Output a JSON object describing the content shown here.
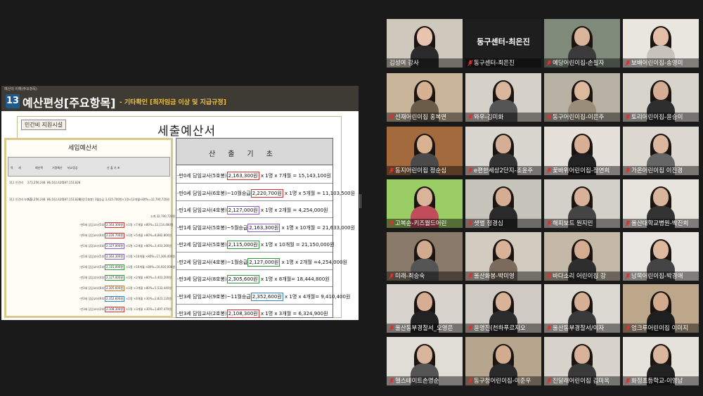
{
  "slide": {
    "header_small": "예산의 이해(주요항목)",
    "number": "13",
    "title": "예산편성[주요항목]",
    "subtitle": "- 기타확인 [최저임금 이상 및 지급규정]",
    "tag": "민간비 지원시설",
    "main_title": "세출예산서",
    "doc": {
      "title": "세입예산서",
      "headers": [
        "목",
        "세",
        "예산액",
        "기정예산",
        "비교증감",
        "산  출  기  초"
      ],
      "row1": [
        "311 인건비",
        "273,256,248",
        "86,102,420",
        "187,153,828"
      ],
      "row2": [
        "311 인건비 보조금",
        "273,256,248",
        "86,102,420",
        "187,153,828",
        "원장(1호봉) 3월승급 3,415,700원×1명×12개월×80%=32,790,720원"
      ],
      "sum_text": "소계 32,790,720원",
      "mini_rows": [
        {
          "pre": "-만0세 담임교사(5호봉)",
          "val": "2,163,300원",
          "post": "×1명 ×7개월 ×80%=12,114,480원",
          "color": "#d9302c"
        },
        {
          "pre": "-만0세 담임교사(6호봉)~10월승급",
          "val": "2,220,700원",
          "post": "×1명 ×5개월 ×80%=8,882,800원",
          "color": "#d9302c"
        },
        {
          "pre": "-만1세 담임교사(4호봉)",
          "val": "2,127,000원",
          "post": "×1명 ×2개월 ×80%=3,403,200원",
          "color": "#8a5cc7"
        },
        {
          "pre": "-만1세 담임교사(5호봉)~5월승급",
          "val": "2,163,300원",
          "post": "×1명 ×10개월 ×80%=17,306,400원",
          "color": "#8a5cc7"
        },
        {
          "pre": "-만2세 담임교사(5호봉)",
          "val": "2,115,000원",
          "post": "×1명 ×10개월 ×80%=16,920,000원",
          "color": "#2f9a3b"
        },
        {
          "pre": "-만2세 담임교사(4호봉)~1월승급",
          "val": "2,127,000원",
          "post": "×1명 ×2개월 ×80%=3,403,200원",
          "color": "#2f9a3b"
        },
        {
          "pre": "-만3세 담임교사(8호봉)",
          "val": "2,305,600원",
          "post": "×1명 ×3개월 ×80%=5,533,440원",
          "color": "#c8782a"
        },
        {
          "pre": "-만3세 담임교사(9호봉)~11월승급",
          "val": "2,352,600원",
          "post": "×1명 ×4개월 ×30%=2,823,120원",
          "color": "#2c86c9"
        },
        {
          "pre": "-만3세 담임교사(2호봉)",
          "val": "2,108,300원",
          "post": "×1명 ×3개월 ×30%=1,897,470원",
          "color": "#d9302c"
        }
      ]
    },
    "calc": {
      "header": "산출기초",
      "rows": [
        {
          "pre": "-만0세 담임교사(5호봉)",
          "val": "2,163,300원",
          "post": " x 1명 x 7개월 = 15,143,100원",
          "color": "#d9302c"
        },
        {
          "pre": "-만0세 담임교사(6호봉)~10월승급",
          "val": "2,220,700원",
          "post": " x 1명 x 5개월 = 11,103,500원",
          "color": "#d9302c"
        },
        {
          "pre": "-만1세 담임교사(4호봉)",
          "val": "2,127,000원",
          "post": " x 1명 x 2개월 =   4,254,000원",
          "color": "#8a5cc7"
        },
        {
          "pre": "-만1세 담임교사(5호봉)~5월승급",
          "val": "2,163,300원",
          "post": " x 1명 x 10개월 =   21,633,000원",
          "color": "#8a5cc7"
        },
        {
          "pre": "-만2세 담임교사(5호봉)",
          "val": "2,115,000원",
          "post": " x 1명 x 10개월 = 21,150,000원",
          "color": "#2f9a3b"
        },
        {
          "pre": "-만2세 담임교사(4호봉)~1월승급",
          "val": "2,127,000원",
          "post": " x 1명 x 2개월 =4,254,000원",
          "color": "#2f9a3b"
        },
        {
          "pre": "-만3세 담임교사(8호봉)",
          "val": "2,305,600원",
          "post": " x 1명 x 8개월= 18,444,800원",
          "color": "#2f9a3b"
        },
        {
          "pre": "-만3세 담임교사(9호봉)~11월승급",
          "val": "2,352,600원",
          "post": " x 1명 x 4개월= 9,410,400원",
          "color": "#2c86c9"
        },
        {
          "pre": "-만3세 담임교사(2호봉)",
          "val": "2,108,300원",
          "post": " x 1명 x 3개월 = 6,324,900원",
          "color": "#d9302c"
        }
      ]
    }
  },
  "participants": [
    {
      "name": "김성여 강사",
      "bg": "#cfc8bc",
      "skin": "#e8c4ae",
      "shirt": "#2a2a2a",
      "active": true,
      "muted": false
    },
    {
      "name": "동구센터-최은진",
      "bg": "#1e1e1e",
      "label_only": true,
      "center": "동구센터-최은진",
      "muted": true
    },
    {
      "name": "예당어린이집-손필자",
      "bg": "#7f8a7a",
      "skin": "#d8b49a",
      "shirt": "#3b3b3b",
      "muted": true
    },
    {
      "name": "보배어린이집-송영미",
      "bg": "#e9e6e0",
      "skin": "#e2bfa6",
      "shirt": "#c7c2bb",
      "muted": true
    },
    {
      "name": "선재어린이집 홍복연",
      "bg": "#c9b59a",
      "skin": "#d6b293",
      "shirt": "#6b5c4a",
      "muted": true
    },
    {
      "name": "와우-김미화",
      "bg": "#d5d0c8",
      "skin": "#d9b69c",
      "shirt": "#555",
      "muted": true
    },
    {
      "name": "동구어린이집-이은주",
      "bg": "#b8b2a5",
      "skin": "#dcb89e",
      "shirt": "#9a8d7a",
      "muted": true
    },
    {
      "name": "토리어린이집-윤승이",
      "bg": "#d7d4cc",
      "skin": "#d4ad93",
      "shirt": "#2e2e2e",
      "muted": true
    },
    {
      "name": "동지어린이집 정순심",
      "bg": "#a36a3e",
      "skin": "#d9b292",
      "shirt": "#4a4a4a",
      "muted": true
    },
    {
      "name": "e편한세상2단지-조윤주",
      "bg": "#d9d5cf",
      "skin": "#d5af95",
      "shirt": "#333",
      "muted": true
    },
    {
      "name": "꽃바위어린이집-정연희",
      "bg": "#e5e1da",
      "skin": "#d7b095",
      "shirt": "#222",
      "muted": true
    },
    {
      "name": "가온어린이집 이진경",
      "bg": "#dcd8d0",
      "skin": "#dbb79d",
      "shirt": "#666",
      "muted": true
    },
    {
      "name": "고복순-키즈월드어린",
      "bg": "#9acd63",
      "skin": "#d9b499",
      "shirt": "#c14d5a",
      "muted": true
    },
    {
      "name": "샛별 정경심",
      "bg": "#c7c4bc",
      "skin": "#d4ad92",
      "shirt": "#2a2a2a",
      "muted": true
    },
    {
      "name": "해피보트 원지민",
      "bg": "#d3d0c9",
      "skin": "#d7b298",
      "shirt": "#444",
      "muted": true
    },
    {
      "name": "울산대학교병원-박진희",
      "bg": "#e7e4de",
      "skin": "#d9b59b",
      "shirt": "#333",
      "muted": true
    },
    {
      "name": "미래-최승숙",
      "bg": "#8a7a6a",
      "skin": "#d1aa8f",
      "shirt": "#555",
      "muted": true
    },
    {
      "name": "울산화봉-박미영",
      "bg": "#d1cbc0",
      "skin": "#d8b397",
      "shirt": "#7a6b5c",
      "muted": true
    },
    {
      "name": "바다소리 어린이집 강",
      "bg": "#c4b8a6",
      "skin": "#d3ac91",
      "shirt": "#2e2e2e",
      "muted": true
    },
    {
      "name": "남목어린이집-박경애",
      "bg": "#e9e6e1",
      "skin": "#dcb99f",
      "shirt": "#444",
      "muted": true
    },
    {
      "name": "울산동부경찰서_오영은",
      "bg": "#d8d4cd",
      "skin": "#d5ae94",
      "shirt": "#222",
      "muted": true
    },
    {
      "name": "윤명진(천하푸르지오",
      "bg": "#cfcac3",
      "skin": "#d8b398",
      "shirt": "#2c2c2c",
      "muted": true
    },
    {
      "name": "울산동부경찰서/이자",
      "bg": "#dcd9d3",
      "skin": "#d7b196",
      "shirt": "#3a3a3a",
      "muted": true
    },
    {
      "name": "엄크루어린이집 이미지",
      "bg": "#bca78a",
      "skin": "#d2aa8e",
      "shirt": "#1f1f1f",
      "muted": true
    },
    {
      "name": "헬스테이트손명순",
      "bg": "#e0ddd7",
      "skin": "#d9b59b",
      "shirt": "#555",
      "muted": true
    },
    {
      "name": "동구청어린이집-이준우",
      "bg": "#b6a68e",
      "skin": "#d3ac90",
      "shirt": "#2a2a2a",
      "muted": true
    },
    {
      "name": "진달래어린이집 김미옥",
      "bg": "#d8d3ca",
      "skin": "#d8b399",
      "shirt": "#3a3a3a",
      "muted": true
    },
    {
      "name": "화정초등학교-이영남",
      "bg": "#e5e2dc",
      "skin": "#dab69c",
      "shirt": "#222",
      "muted": true
    }
  ],
  "colors": {
    "active_border": "#c9d84b",
    "mic_muted": "#e0302c"
  }
}
